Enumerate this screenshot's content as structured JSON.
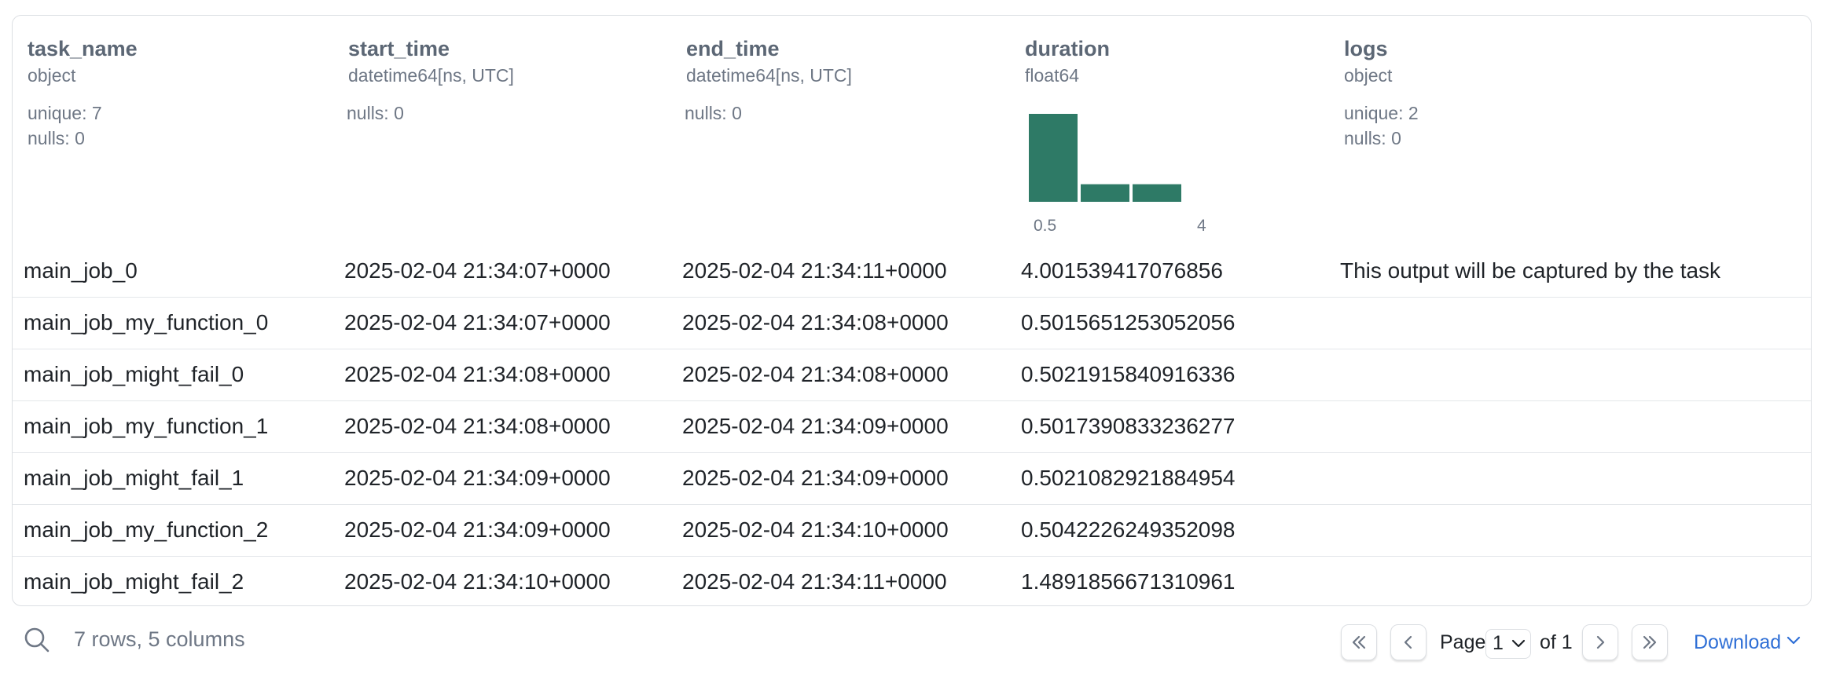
{
  "columns": [
    {
      "name": "task_name",
      "dtype": "object",
      "stats": [
        "unique: 7",
        "nulls: 0"
      ]
    },
    {
      "name": "start_time",
      "dtype": "datetime64[ns, UTC]",
      "stats": [
        "nulls: 0"
      ]
    },
    {
      "name": "end_time",
      "dtype": "datetime64[ns, UTC]",
      "stats": [
        "nulls: 0"
      ]
    },
    {
      "name": "duration",
      "dtype": "float64",
      "stats": []
    },
    {
      "name": "logs",
      "dtype": "object",
      "stats": [
        "unique: 2",
        "nulls: 0"
      ]
    }
  ],
  "histogram": {
    "min_label": "0.5",
    "max_label": "4",
    "bin_heights": [
      1.0,
      0.2,
      0.2
    ],
    "color": "#2e7a66"
  },
  "rows": [
    [
      "main_job_0",
      "2025-02-04 21:34:07+0000",
      "2025-02-04 21:34:11+0000",
      "4.001539417076856",
      "This output will be captured by the task"
    ],
    [
      "main_job_my_function_0",
      "2025-02-04 21:34:07+0000",
      "2025-02-04 21:34:08+0000",
      "0.5015651253052056",
      ""
    ],
    [
      "main_job_might_fail_0",
      "2025-02-04 21:34:08+0000",
      "2025-02-04 21:34:08+0000",
      "0.5021915840916336",
      ""
    ],
    [
      "main_job_my_function_1",
      "2025-02-04 21:34:08+0000",
      "2025-02-04 21:34:09+0000",
      "0.5017390833236277",
      ""
    ],
    [
      "main_job_might_fail_1",
      "2025-02-04 21:34:09+0000",
      "2025-02-04 21:34:09+0000",
      "0.5021082921884954",
      ""
    ],
    [
      "main_job_my_function_2",
      "2025-02-04 21:34:09+0000",
      "2025-02-04 21:34:10+0000",
      "0.5042226249352098",
      ""
    ],
    [
      "main_job_might_fail_2",
      "2025-02-04 21:34:10+0000",
      "2025-02-04 21:34:11+0000",
      "1.4891856671310961",
      ""
    ]
  ],
  "footer": {
    "summary": "7 rows, 5 columns",
    "page_label": "Page",
    "page_value": "1",
    "of_label": "of 1",
    "download_label": "Download"
  },
  "icons": {
    "search": "search-icon",
    "first": "chevrons-left-icon",
    "prev": "chevron-left-icon",
    "next": "chevron-right-icon",
    "last": "chevrons-right-icon",
    "dropdown": "chevron-down-icon"
  }
}
